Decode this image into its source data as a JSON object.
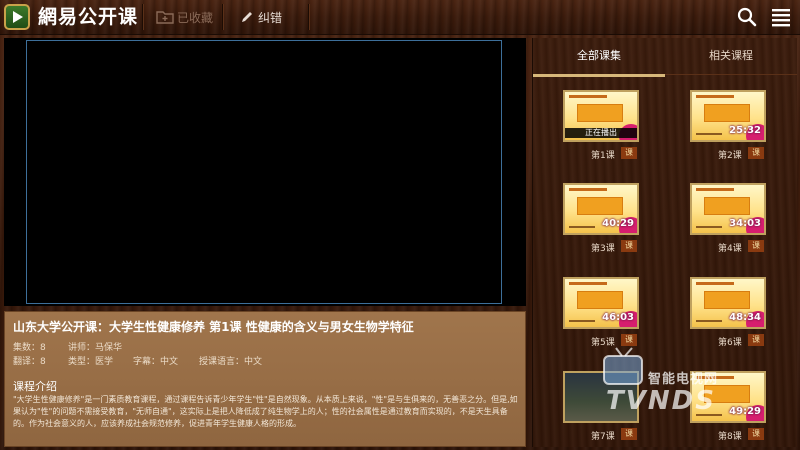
{
  "app": {
    "title": "網易公开课",
    "favorite_label": "已收藏",
    "correct_label": "纠错"
  },
  "icons": {
    "logo": "play-logo-icon",
    "favorite": "folder-icon",
    "correct": "pencil-icon",
    "search": "search-icon",
    "menu": "menu-icon"
  },
  "course": {
    "title": "山东大学公开课：大学生性健康修养 第1课 性健康的含义与男女生物学特征",
    "episodes": "集数：8",
    "lecturer": "讲师：马保华",
    "translated": "翻译：8",
    "type": "类型：医学",
    "subtitle": "字幕：中文",
    "language": "授课语言：中文",
    "intro_heading": "课程介绍",
    "intro_text": "\"大学生性健康修养\"是一门素质教育课程，通过课程告诉青少年学生\"性\"是自然现象。从本质上来说，\"性\"是与生俱来的，无善恶之分。但是,如果认为\"性\"的问题不需接受教育，\"无师自通\"，这实际上是把人降低成了纯生物学上的人；性的社会属性是通过教育而实现的，不是天生具备的。作为社会意义的人，应该养成社会规范修养，促进青年学生健康人格的形成。"
  },
  "tabs": [
    {
      "label": "全部课集",
      "active": true
    },
    {
      "label": "相关课程",
      "active": false
    }
  ],
  "lessons": [
    {
      "label": "第1课",
      "badge": "课",
      "duration": "",
      "playing_label": "正在播出"
    },
    {
      "label": "第2课",
      "badge": "课",
      "duration": "25:32"
    },
    {
      "label": "第3课",
      "badge": "课",
      "duration": "40:29"
    },
    {
      "label": "第4课",
      "badge": "课",
      "duration": "34:03"
    },
    {
      "label": "第5课",
      "badge": "课",
      "duration": "46:03"
    },
    {
      "label": "第6课",
      "badge": "课",
      "duration": "48:34"
    },
    {
      "label": "第7课",
      "badge": "课",
      "duration": ""
    },
    {
      "label": "第8课",
      "badge": "课",
      "duration": "49:29"
    }
  ],
  "watermark": {
    "text": "智能电视网",
    "brand": "TVNDS"
  },
  "colors": {
    "accent": "#d7b87a",
    "info_panel": "#9a6f47",
    "video_border": "#3d6f9a"
  }
}
